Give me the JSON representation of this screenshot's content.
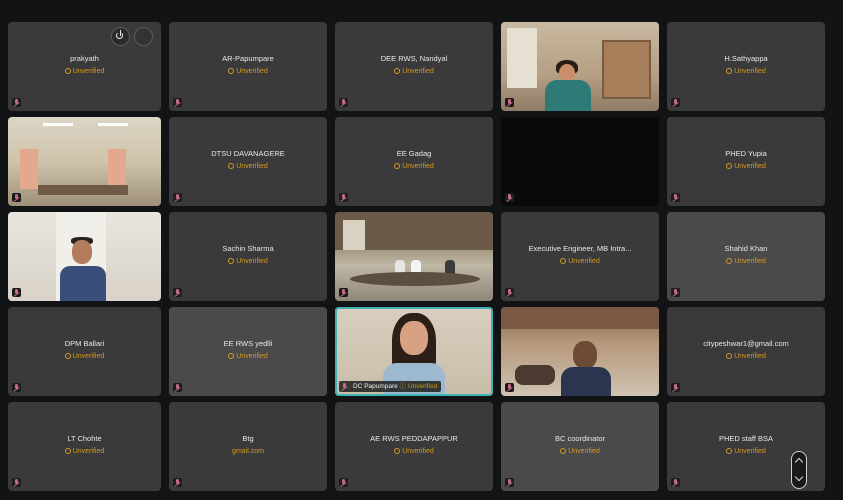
{
  "status_label": "Unverified",
  "tiles": [
    {
      "name": "prakyath",
      "status": "Unverified"
    },
    {
      "name": "AR-Papumpare",
      "status": "Unverified"
    },
    {
      "name": "DEE RWS, Nandyal",
      "status": "Unverified"
    },
    {
      "name": "",
      "status": ""
    },
    {
      "name": "H.Sathyappa",
      "status": "Unverified"
    },
    {
      "name": "",
      "status": ""
    },
    {
      "name": "DTSU DAVANAGERE",
      "status": "Unverified"
    },
    {
      "name": "EE Gadag",
      "status": "Unverified"
    },
    {
      "name": "",
      "status": ""
    },
    {
      "name": "PHED Yupia",
      "status": "Unverified"
    },
    {
      "name": "",
      "status": ""
    },
    {
      "name": "Sachin Sharma",
      "status": "Unverified"
    },
    {
      "name": "",
      "status": ""
    },
    {
      "name": "Executive Engineer, MB Intra...",
      "status": "Unverified"
    },
    {
      "name": "Shahid Khan",
      "status": "Unverified"
    },
    {
      "name": "DPM Ballari",
      "status": "Unverified"
    },
    {
      "name": "EE RWS yedlli",
      "status": "Unverified"
    },
    {
      "name": "DC Papumpare",
      "status": "Unverified"
    },
    {
      "name": "",
      "status": ""
    },
    {
      "name": "citypeshwar1@gmail.com",
      "status": "Unverified"
    },
    {
      "name": "LT Chohte",
      "status": "Unverified"
    },
    {
      "name": "Btg",
      "status": "gmail.com"
    },
    {
      "name": "AE RWS PEDDAPAPPUR",
      "status": "Unverified"
    },
    {
      "name": "BC coordinator",
      "status": "Unverified"
    },
    {
      "name": "PHED staff BSA",
      "status": "Unverified"
    }
  ],
  "active_speaker": {
    "name": "DC Papumpare",
    "status": "Unverified"
  },
  "icons": {
    "leave": "power-icon",
    "more": "more-options-icon",
    "mic_off": "mic-muted-icon",
    "scroll": "scroll-pager-icon"
  },
  "colors": {
    "tile_bg": "#3a3a3c",
    "status": "#d59a1e",
    "active_border": "#3fb3b3",
    "mic_muted": "#c36b8a"
  }
}
